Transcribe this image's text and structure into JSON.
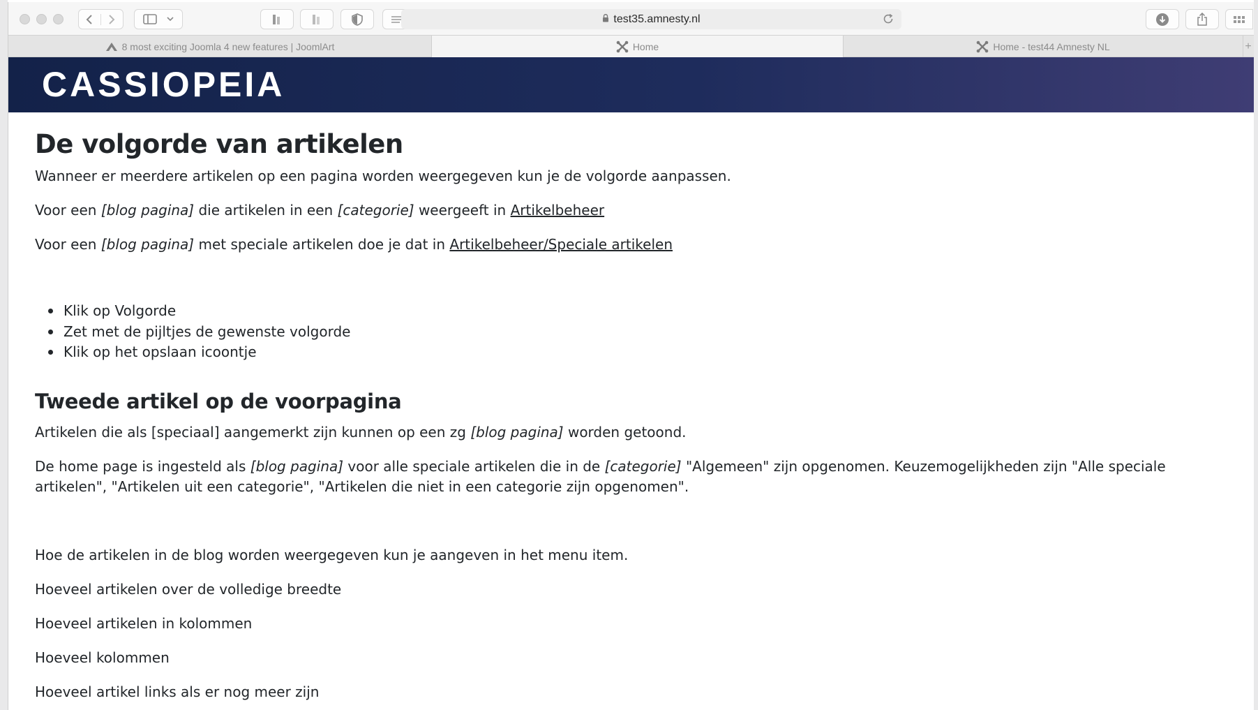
{
  "browser": {
    "url": "test35.amnesty.nl",
    "tabs": [
      {
        "label": "8 most exciting Joomla 4 new features | JoomlArt",
        "icon": "joomlart-icon",
        "active": false
      },
      {
        "label": "Home",
        "icon": "joomla-icon",
        "active": true
      },
      {
        "label": "Home - test44 Amnesty NL",
        "icon": "joomla-icon",
        "active": false
      }
    ],
    "new_tab_symbol": "+"
  },
  "site": {
    "brand": "CASSIOPEIA",
    "banner_colors": [
      "#132249",
      "#3f3d74"
    ]
  },
  "article": {
    "title": "De volgorde van artikelen",
    "intro": "Wanneer er meerdere artikelen op een pagina worden weergegeven kun je de volgorde aanpassen.",
    "p2": {
      "a": "Voor een ",
      "em1": "[blog pagina]",
      "b": " die artikelen in een ",
      "em2": "[categorie]",
      "c": " weergeeft in ",
      "link": "Artikelbeheer"
    },
    "p3": {
      "a": "Voor een ",
      "em1": "[blog pagina]",
      "b": " met speciale artikelen doe je dat in ",
      "link": "Artikelbeheer/Speciale artikelen"
    },
    "steps": [
      "Klik op Volgorde",
      "Zet met de pijltjes de gewenste volgorde",
      "Klik op het opslaan icoontje"
    ],
    "section2_title": "Tweede artikel op de voorpagina",
    "s2p1": {
      "a": "Artikelen die als [speciaal] aangemerkt zijn kunnen op een zg ",
      "em1": "[blog pagina]",
      "b": " worden getoond."
    },
    "s2p2": {
      "a": "De home page is ingesteld als ",
      "em1": "[blog pagina]",
      "b": " voor alle speciale artikelen die in de ",
      "em2": "[categorie]",
      "c": " \"Algemeen\" zijn opgenomen. Keuzemogelijkheden zijn \"Alle speciale artikelen\", \"Artikelen uit een categorie\", \"Artikelen die niet in een categorie zijn opgenomen\"."
    },
    "s2p3": "Hoe de artikelen in de blog worden weergegeven kun je aangeven in het menu item.",
    "s2p4": "Hoeveel artikelen over de volledige breedte",
    "s2p5": "Hoeveel artikelen in kolommen",
    "s2p6": "Hoeveel kolommen",
    "s2p7": "Hoeveel artikel links als er nog meer zijn"
  }
}
